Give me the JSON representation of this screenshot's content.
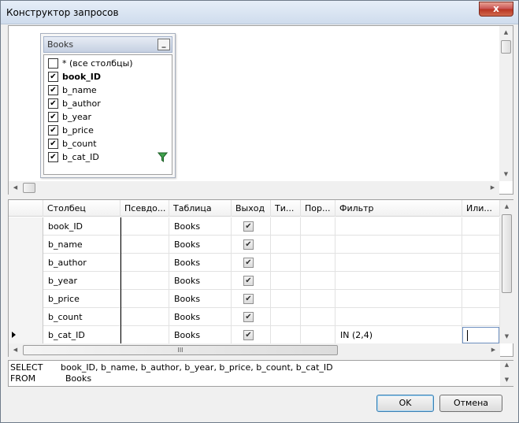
{
  "window": {
    "title": "Конструктор запросов",
    "close_glyph": "x"
  },
  "diagram": {
    "table": {
      "title": "Books",
      "minimize_glyph": "_",
      "items": [
        {
          "label": "* (все столбцы)",
          "checked": false,
          "bold": false,
          "filter": false
        },
        {
          "label": "book_ID",
          "checked": true,
          "bold": true,
          "filter": false
        },
        {
          "label": "b_name",
          "checked": true,
          "bold": false,
          "filter": false
        },
        {
          "label": "b_author",
          "checked": true,
          "bold": false,
          "filter": false
        },
        {
          "label": "b_year",
          "checked": true,
          "bold": false,
          "filter": false
        },
        {
          "label": "b_price",
          "checked": true,
          "bold": false,
          "filter": false
        },
        {
          "label": "b_count",
          "checked": true,
          "bold": false,
          "filter": false
        },
        {
          "label": "b_cat_ID",
          "checked": true,
          "bold": false,
          "filter": true
        }
      ]
    }
  },
  "grid": {
    "headers": [
      "Столбец",
      "Псевдо...",
      "Таблица",
      "Выход",
      "Ти...",
      "Пор...",
      "Фильтр",
      "Или..."
    ],
    "rows": [
      {
        "column": "book_ID",
        "alias": "",
        "table": "Books",
        "output": true,
        "type": "",
        "order": "",
        "filter": "",
        "or": "",
        "current": false
      },
      {
        "column": "b_name",
        "alias": "",
        "table": "Books",
        "output": true,
        "type": "",
        "order": "",
        "filter": "",
        "or": "",
        "current": false
      },
      {
        "column": "b_author",
        "alias": "",
        "table": "Books",
        "output": true,
        "type": "",
        "order": "",
        "filter": "",
        "or": "",
        "current": false
      },
      {
        "column": "b_year",
        "alias": "",
        "table": "Books",
        "output": true,
        "type": "",
        "order": "",
        "filter": "",
        "or": "",
        "current": false
      },
      {
        "column": "b_price",
        "alias": "",
        "table": "Books",
        "output": true,
        "type": "",
        "order": "",
        "filter": "",
        "or": "",
        "current": false
      },
      {
        "column": "b_count",
        "alias": "",
        "table": "Books",
        "output": true,
        "type": "",
        "order": "",
        "filter": "",
        "or": "",
        "current": false
      },
      {
        "column": "b_cat_ID",
        "alias": "",
        "table": "Books",
        "output": true,
        "type": "",
        "order": "",
        "filter": "IN (2,4)",
        "or": "",
        "current": true
      }
    ],
    "hscroll_grip": "III"
  },
  "sql": {
    "lines": [
      {
        "keyword": "SELECT",
        "text": "book_ID, b_name, b_author, b_year, b_price, b_count, b_cat_ID"
      },
      {
        "keyword": "FROM",
        "text": "Books"
      }
    ]
  },
  "buttons": {
    "ok": "OK",
    "cancel": "Отмена"
  },
  "colors": {
    "title_bar": "#cfdced",
    "close_button": "#c75050",
    "selection_border": "#6d8fbf"
  },
  "icons": {
    "filter": "funnel-icon",
    "check": "checkmark-icon",
    "row_pointer": "row-pointer-icon"
  }
}
